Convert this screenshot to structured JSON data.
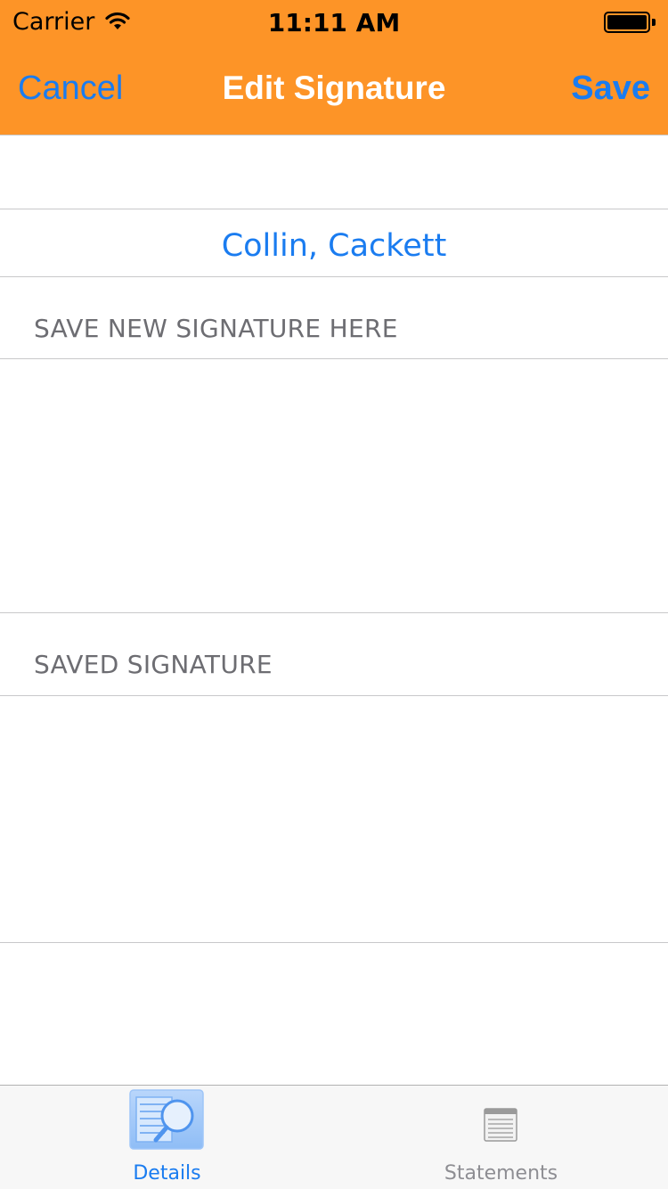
{
  "status_bar": {
    "carrier": "Carrier",
    "time": "11:11 AM",
    "wifi_icon": "wifi-icon",
    "battery_icon": "battery-full-icon"
  },
  "nav": {
    "cancel_label": "Cancel",
    "title": "Edit Signature",
    "save_label": "Save",
    "background_color": "#fd9427",
    "button_color": "#1a7cf0",
    "title_color": "#ffffff"
  },
  "signer": {
    "name": "Collin, Cackett"
  },
  "sections": {
    "new_signature_label": "SAVE NEW SIGNATURE HERE",
    "saved_signature_label": "SAVED SIGNATURE"
  },
  "tabbar": {
    "tabs": [
      {
        "label": "Details",
        "icon": "details-magnifier-icon",
        "selected": true
      },
      {
        "label": "Statements",
        "icon": "statements-list-icon",
        "selected": false
      }
    ]
  }
}
